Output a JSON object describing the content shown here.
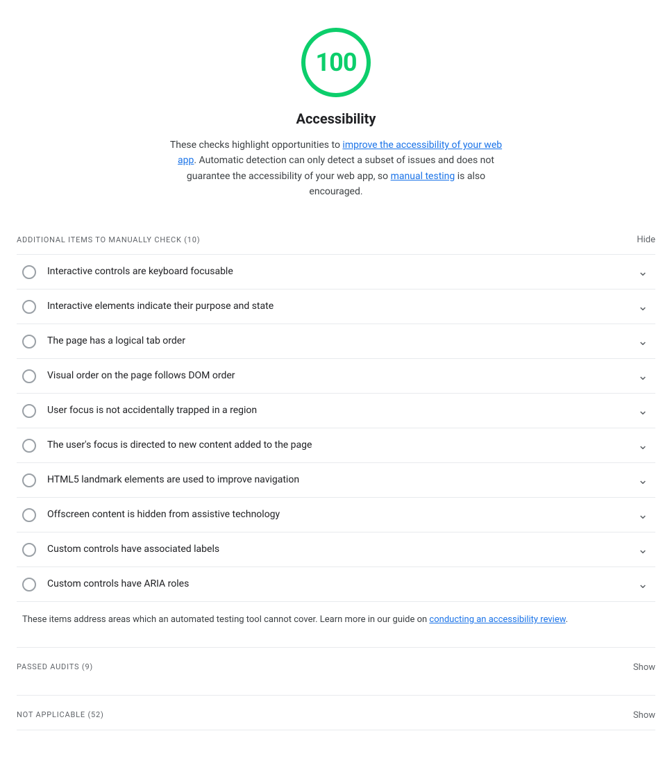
{
  "score": {
    "value": "100",
    "label": "Accessibility",
    "description_part1": "These checks highlight opportunities to ",
    "link1_text": "improve the accessibility of your web app",
    "link1_href": "#",
    "description_part2": ". Automatic detection can only detect a subset of issues and does not guarantee the accessibility of your web app, so ",
    "link2_text": "manual testing",
    "link2_href": "#",
    "description_part3": " is also encouraged."
  },
  "manual_section": {
    "title": "ADDITIONAL ITEMS TO MANUALLY CHECK",
    "count": "(10)",
    "action_label": "Hide"
  },
  "audit_items": [
    {
      "label": "Interactive controls are keyboard focusable"
    },
    {
      "label": "Interactive elements indicate their purpose and state"
    },
    {
      "label": "The page has a logical tab order"
    },
    {
      "label": "Visual order on the page follows DOM order"
    },
    {
      "label": "User focus is not accidentally trapped in a region"
    },
    {
      "label": "The user's focus is directed to new content added to the page"
    },
    {
      "label": "HTML5 landmark elements are used to improve navigation"
    },
    {
      "label": "Offscreen content is hidden from assistive technology"
    },
    {
      "label": "Custom controls have associated labels"
    },
    {
      "label": "Custom controls have ARIA roles"
    }
  ],
  "footer_note": {
    "text_part1": "These items address areas which an automated testing tool cannot cover. Learn more in our guide on ",
    "link_text": "conducting an accessibility review",
    "link_href": "#",
    "text_part2": "."
  },
  "passed_section": {
    "title": "PASSED AUDITS",
    "count": "(9)",
    "action_label": "Show"
  },
  "not_applicable_section": {
    "title": "NOT APPLICABLE",
    "count": "(52)",
    "action_label": "Show"
  }
}
